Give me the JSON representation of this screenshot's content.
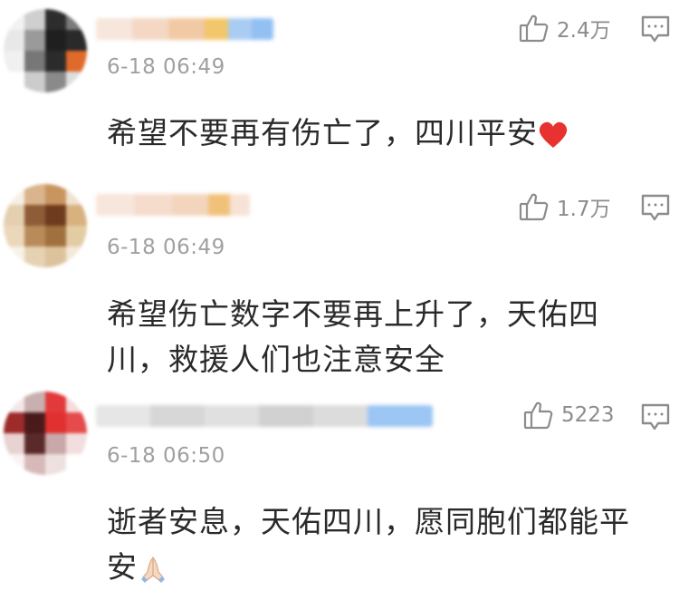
{
  "comments": [
    {
      "time": "6-18 06:49",
      "likes": "2.4万",
      "text": "希望不要再有伤亡了，四川平安",
      "emoji": "red-heart"
    },
    {
      "time": "6-18 06:49",
      "likes": "1.7万",
      "text": "希望伤亡数字不要再上升了，天佑四川，救援人们也注意安全",
      "emoji": ""
    },
    {
      "time": "6-18 06:50",
      "likes": "5223",
      "text": "逝者安息，天佑四川，愿同胞们都能平安",
      "emoji": "folded-hands"
    }
  ],
  "colors": {
    "icon": "#8c8c8c",
    "time": "#a0a0a0",
    "text": "#2a2a2a",
    "heart": "#e8322f"
  }
}
